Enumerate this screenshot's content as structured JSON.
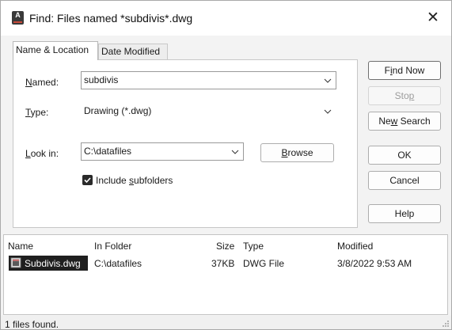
{
  "window": {
    "title": "Find: Files named *subdivis*.dwg",
    "close_glyph": "✕",
    "app_icon_letter": "A"
  },
  "tabs": [
    {
      "label": "Name & Location",
      "active": true
    },
    {
      "label": "Date Modified",
      "active": false
    }
  ],
  "form": {
    "named": {
      "label_u": "N",
      "label_rest": "amed:",
      "value": "subdivis"
    },
    "type": {
      "label_u": "T",
      "label_rest": "ype:",
      "value": "Drawing (*.dwg)"
    },
    "look_in": {
      "label_u": "L",
      "label_rest": "ook in:",
      "value": "C:\\datafiles"
    },
    "browse": {
      "u": "B",
      "rest": "rowse"
    },
    "include_subfolders": {
      "pre": "Include ",
      "u": "s",
      "rest": "ubfolders",
      "checked": true
    }
  },
  "buttons": {
    "find_now": {
      "pre": "F",
      "u": "i",
      "rest": "nd Now"
    },
    "stop": {
      "pre": "Sto",
      "u": "p",
      "rest": ""
    },
    "new_search": {
      "pre": "Ne",
      "u": "w",
      "rest": " Search"
    },
    "ok": "OK",
    "cancel": "Cancel",
    "help": "Help"
  },
  "results": {
    "columns": [
      "Name",
      "In Folder",
      "Size",
      "Type",
      "Modified"
    ],
    "rows": [
      {
        "name": "Subdivis.dwg",
        "folder": "C:\\datafiles",
        "size": "37KB",
        "type": "DWG File",
        "modified": "3/8/2022 9:53 AM",
        "selected": true
      }
    ]
  },
  "status": {
    "text": "1 files found."
  },
  "icons": [
    "autocad-app-icon",
    "close-icon",
    "chevron-down-icon",
    "checkmark-icon",
    "dwg-file-icon",
    "resize-grip-icon"
  ]
}
